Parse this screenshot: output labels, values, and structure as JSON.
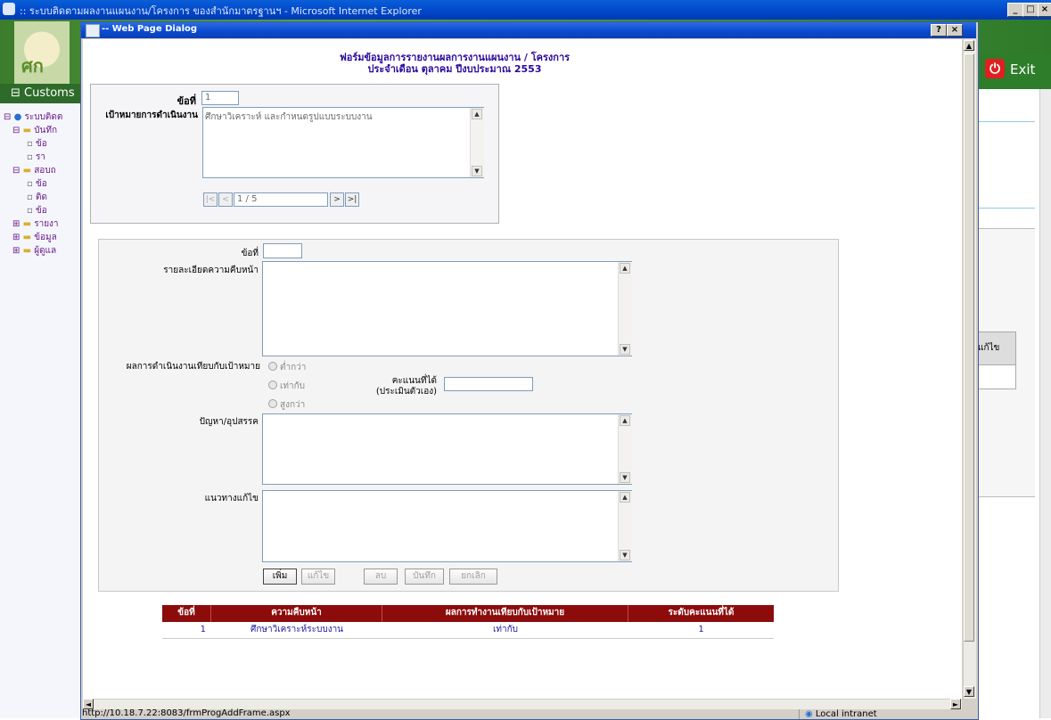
{
  "background_window": {
    "title": ":: ระบบติดตามผลงานแผนงาน/โครงการ ของสำนักมาตรฐานฯ - Microsoft Internet Explorer",
    "nav_label": "Customs",
    "exit_label": "Exit",
    "tree": [
      {
        "label": "ระบบติดต",
        "level": 0
      },
      {
        "label": "บันทึก",
        "level": 1
      },
      {
        "label": "ข้อ",
        "level": 2
      },
      {
        "label": "รา",
        "level": 2
      },
      {
        "label": "สอบถ",
        "level": 1
      },
      {
        "label": "ข้อ",
        "level": 2
      },
      {
        "label": "ติด",
        "level": 2
      },
      {
        "label": "ข้อ",
        "level": 2
      },
      {
        "label": "รายงา",
        "level": 1
      },
      {
        "label": "ข้อมูล",
        "level": 1
      },
      {
        "label": "ผู้ดูแล",
        "level": 1
      }
    ],
    "right_table_header": "แก้ไข"
  },
  "dialog": {
    "title": "-- Web Page Dialog",
    "help_button": "?",
    "close_button": "×",
    "heading_line1": "ฟอร์มข้อมูลการรายงานผลการงานแผนงาน / โครงการ",
    "heading_line2": "ประจำเดือน ตุลาคม  ปีงบประมาณ 2553",
    "status_url": "http://10.18.7.22:8083/frmProgAddFrame.aspx",
    "status_zone": "Local intranet"
  },
  "goal_panel": {
    "item_no_label": "ข้อที่",
    "item_no_value": "1",
    "goal_label": "เป้าหมายการดำเนินงาน",
    "goal_text": "ศึกษาวิเคราะห์ และกำหนดรูปแบบระบบงาน",
    "pager": {
      "first": "|<",
      "prev": "<",
      "position": "1 / 5",
      "next": ">",
      "last": ">|"
    }
  },
  "progress_form": {
    "item_no_label": "ข้อที่",
    "item_no_value": "",
    "detail_label": "รายละเอียดความคืบหน้า",
    "result_label": "ผลการดำเนินงานเทียบกับเป้าหมาย",
    "radio_options": [
      "ต่ำกว่า",
      "เท่ากับ",
      "สูงกว่า"
    ],
    "score_label_line1": "คะแนนที่ได้",
    "score_label_line2": "(ประเมินตัวเอง)",
    "score_value": "",
    "problem_label": "ปัญหา/อุปสรรค",
    "solution_label": "แนวทางแก้ไข",
    "buttons": {
      "add": "เพิ่ม",
      "edit": "แก้ไข",
      "delete": "ลบ",
      "save": "บันทึก",
      "cancel": "ยกเลิก"
    }
  },
  "progress_table": {
    "headers": [
      "ข้อที่",
      "ความคืบหน้า",
      "ผลการทำงานเทียบกับเป้าหมาย",
      "ระดับคะแนนที่ได้"
    ],
    "rows": [
      {
        "no": "1",
        "progress": "ศึกษาวิเคราะห์ระบบงาน",
        "result": "เท่ากับ",
        "score": "1"
      }
    ]
  }
}
